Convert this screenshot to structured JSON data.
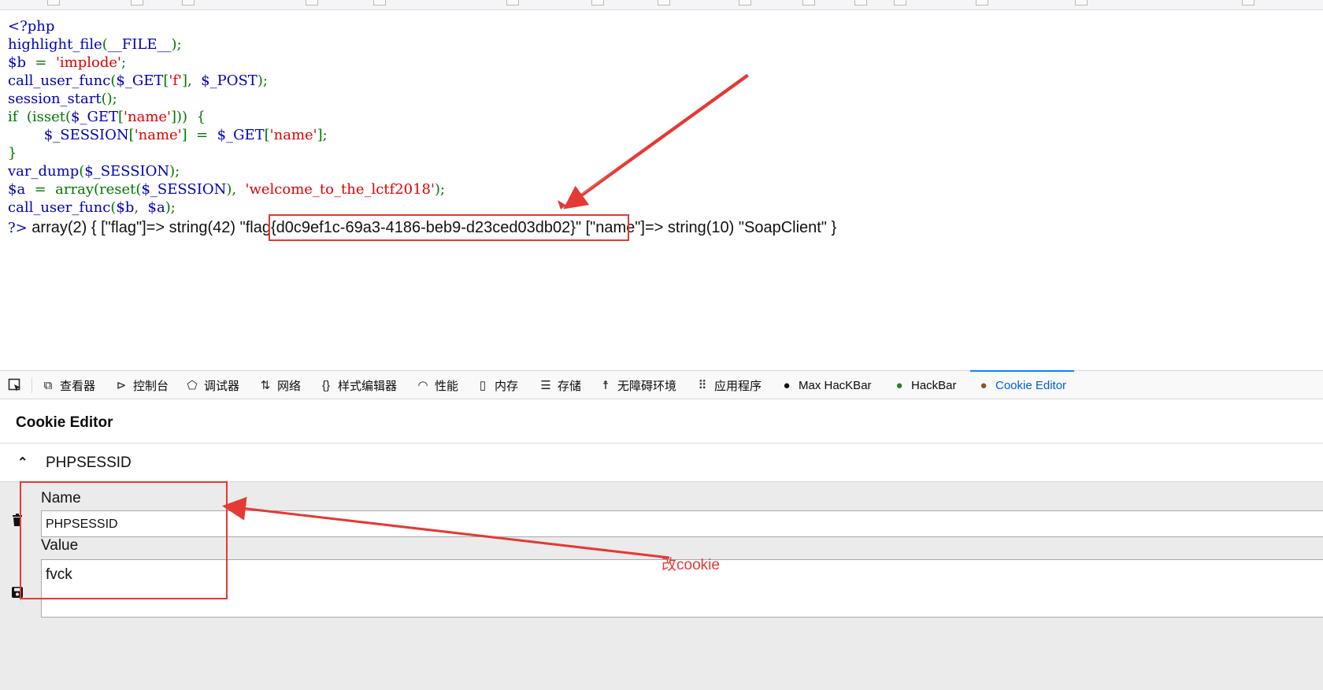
{
  "code_lines": [
    [
      {
        "t": "<?php",
        "c": "blue"
      }
    ],
    [
      {
        "t": "highlight_file",
        "c": "blue"
      },
      {
        "t": "(",
        "c": "green"
      },
      {
        "t": "__FILE__",
        "c": "blue"
      },
      {
        "t": ");",
        "c": "green"
      }
    ],
    [
      {
        "t": "$b  ",
        "c": "blue"
      },
      {
        "t": "=  ",
        "c": "green"
      },
      {
        "t": "'implode'",
        "c": "red"
      },
      {
        "t": ";",
        "c": "green"
      }
    ],
    [
      {
        "t": "call_user_func",
        "c": "blue"
      },
      {
        "t": "(",
        "c": "green"
      },
      {
        "t": "$_GET",
        "c": "blue"
      },
      {
        "t": "[",
        "c": "green"
      },
      {
        "t": "'f'",
        "c": "red"
      },
      {
        "t": "],  ",
        "c": "green"
      },
      {
        "t": "$_POST",
        "c": "blue"
      },
      {
        "t": ");",
        "c": "green"
      }
    ],
    [
      {
        "t": "session_start",
        "c": "blue"
      },
      {
        "t": "();",
        "c": "green"
      }
    ],
    [
      {
        "t": "if  (isset(",
        "c": "green"
      },
      {
        "t": "$_GET",
        "c": "blue"
      },
      {
        "t": "[",
        "c": "green"
      },
      {
        "t": "'name'",
        "c": "red"
      },
      {
        "t": "]))  {",
        "c": "green"
      }
    ],
    [
      {
        "t": "        ",
        "c": "green"
      },
      {
        "t": "$_SESSION",
        "c": "blue"
      },
      {
        "t": "[",
        "c": "green"
      },
      {
        "t": "'name'",
        "c": "red"
      },
      {
        "t": "]  =  ",
        "c": "green"
      },
      {
        "t": "$_GET",
        "c": "blue"
      },
      {
        "t": "[",
        "c": "green"
      },
      {
        "t": "'name'",
        "c": "red"
      },
      {
        "t": "];",
        "c": "green"
      }
    ],
    [
      {
        "t": "}",
        "c": "green"
      }
    ],
    [
      {
        "t": "var_dump",
        "c": "blue"
      },
      {
        "t": "(",
        "c": "green"
      },
      {
        "t": "$_SESSION",
        "c": "blue"
      },
      {
        "t": ");",
        "c": "green"
      }
    ],
    [
      {
        "t": "$a  ",
        "c": "blue"
      },
      {
        "t": "=  array(reset(",
        "c": "green"
      },
      {
        "t": "$_SESSION",
        "c": "blue"
      },
      {
        "t": "),  ",
        "c": "green"
      },
      {
        "t": "'welcome_to_the_lctf2018'",
        "c": "red"
      },
      {
        "t": ");",
        "c": "green"
      }
    ],
    [
      {
        "t": "call_user_func",
        "c": "blue"
      },
      {
        "t": "(",
        "c": "green"
      },
      {
        "t": "$b",
        "c": "blue"
      },
      {
        "t": ",  ",
        "c": "green"
      },
      {
        "t": "$a",
        "c": "blue"
      },
      {
        "t": ");",
        "c": "green"
      }
    ]
  ],
  "output": {
    "php_close": "?>",
    "text": " array(2) { [\"flag\"]=> string(42) \"flag{d0c9ef1c-69a3-4186-beb9-d23ced03db02}\" [\"name\"]=> string(10) \"SoapClient\" }"
  },
  "devtools": {
    "tools": [
      {
        "label": "查看器",
        "icon": "inspector-icon",
        "glyph": "⧉"
      },
      {
        "label": "控制台",
        "icon": "console-icon",
        "glyph": "⊳"
      },
      {
        "label": "调试器",
        "icon": "debugger-icon",
        "glyph": "⬠"
      },
      {
        "label": "网络",
        "icon": "network-icon",
        "glyph": "⇅"
      },
      {
        "label": "样式编辑器",
        "icon": "style-editor-icon",
        "glyph": "{}"
      },
      {
        "label": "性能",
        "icon": "performance-icon",
        "glyph": "◠"
      },
      {
        "label": "内存",
        "icon": "memory-icon",
        "glyph": "▯"
      },
      {
        "label": "存储",
        "icon": "storage-icon",
        "glyph": "☰"
      },
      {
        "label": "无障碍环境",
        "icon": "accessibility-icon",
        "glyph": "☨"
      },
      {
        "label": "应用程序",
        "icon": "application-icon",
        "glyph": "⠿"
      },
      {
        "label": "Max HacKBar",
        "icon": "max-hackbar-icon",
        "glyph": "●"
      },
      {
        "label": "HackBar",
        "icon": "hackbar-icon",
        "glyph": "●"
      },
      {
        "label": "Cookie Editor",
        "icon": "cookie-icon",
        "glyph": "●"
      }
    ],
    "active_tool": "Cookie Editor",
    "accent": "#0060df"
  },
  "cookie_editor": {
    "title": "Cookie Editor",
    "cookie_header": "PHPSESSID",
    "name_label": "Name",
    "name_value": "PHPSESSID",
    "value_label": "Value",
    "value_value": "fvck"
  },
  "annotation": "改cookie",
  "colors": {
    "php_blue": "#0000BB",
    "php_green": "#007700",
    "php_red": "#DD0000",
    "annotation_red": "#e53935"
  }
}
